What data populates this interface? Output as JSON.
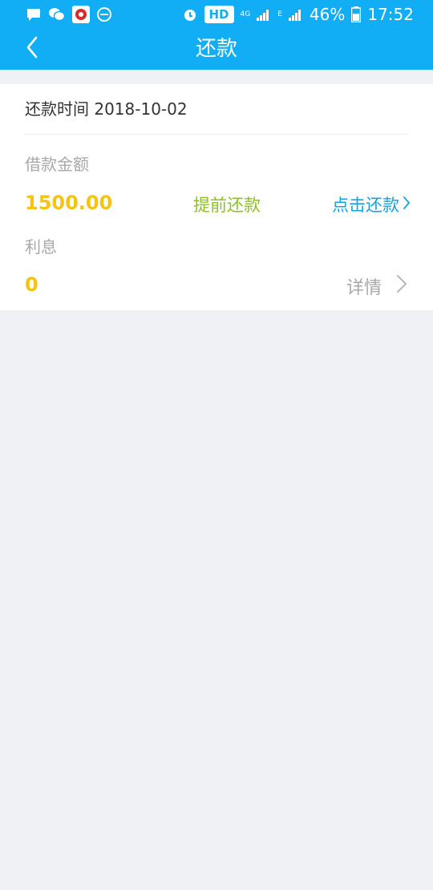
{
  "status_bar": {
    "hd_label": "HD",
    "network_4g": "4G",
    "network_e": "E",
    "battery": "46%",
    "time": "17:52",
    "icons": [
      "message-icon",
      "wechat-icon",
      "app-icon",
      "dnd-icon",
      "alarm-icon",
      "signal-icon",
      "battery-icon"
    ]
  },
  "header": {
    "title": "还款",
    "back_icon": "chevron-left-icon"
  },
  "repayment": {
    "time_label": "还款时间",
    "time_value": "2018-10-02",
    "loan_label": "借款金额",
    "loan_amount": "1500.00",
    "early_repay_label": "提前还款",
    "click_repay_label": "点击还款",
    "interest_label": "利息",
    "interest_value": "0",
    "details_label": "详情"
  },
  "colors": {
    "brand": "#11adf5",
    "amount": "#f5c313",
    "early_repay": "#8cc21d",
    "link": "#14a3e6",
    "muted": "#a8a8a8",
    "background": "#eff1f4"
  }
}
